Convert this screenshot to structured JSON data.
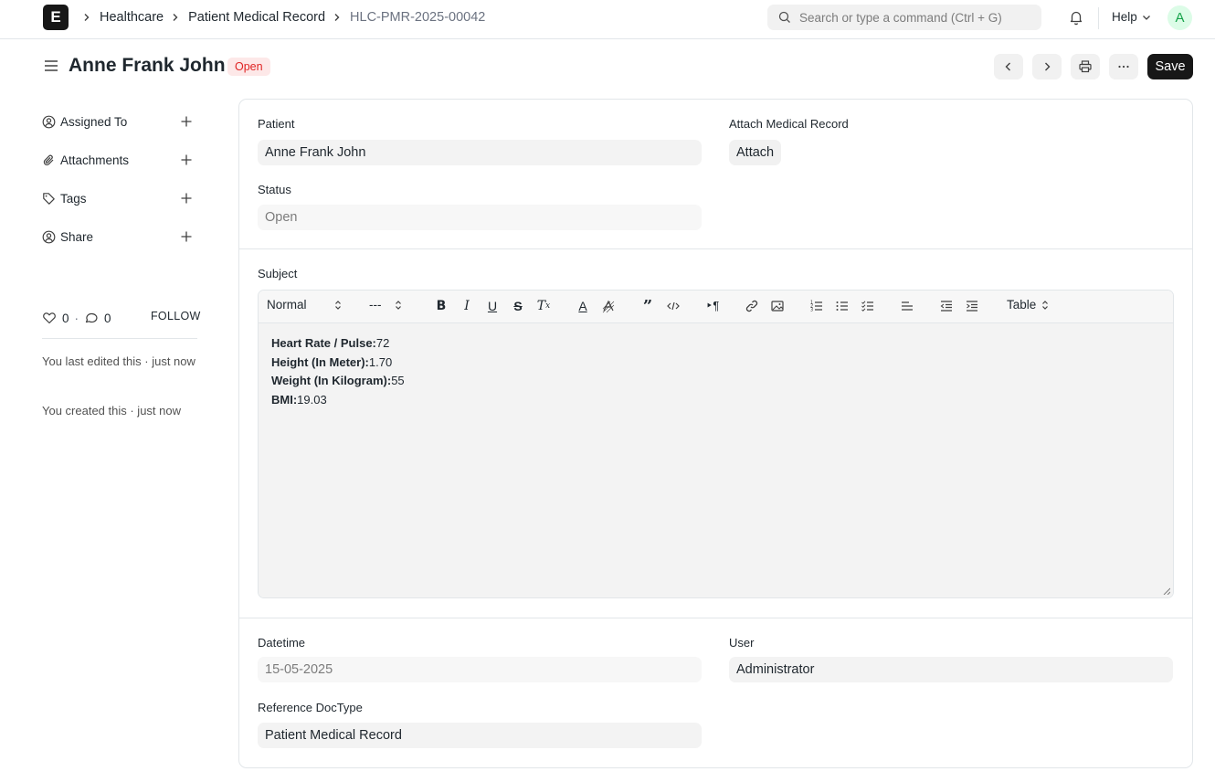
{
  "navbar": {
    "logo_letter": "E",
    "breadcrumbs": [
      "Healthcare",
      "Patient Medical Record",
      "HLC-PMR-2025-00042"
    ],
    "search_placeholder": "Search or type a command (Ctrl + G)",
    "help_label": "Help",
    "avatar_letter": "A"
  },
  "page": {
    "title": "Anne Frank John",
    "status": "Open",
    "save_label": "Save",
    "colors": {
      "status_bg": "#fde8e8",
      "status_text": "#e02424",
      "primary": "#171717"
    }
  },
  "sidebar": {
    "items": [
      {
        "label": "Assigned To",
        "icon": "user-circle-icon"
      },
      {
        "label": "Attachments",
        "icon": "paperclip-icon"
      },
      {
        "label": "Tags",
        "icon": "tag-icon"
      },
      {
        "label": "Share",
        "icon": "share-user-icon"
      }
    ],
    "likes": "0",
    "comments": "0",
    "follow_label": "FOLLOW",
    "last_edited": "You last edited this · just now",
    "created": "You created this · just now"
  },
  "form": {
    "patient": {
      "label": "Patient",
      "value": "Anne Frank John"
    },
    "attach": {
      "label": "Attach Medical Record",
      "button": "Attach"
    },
    "status": {
      "label": "Status",
      "placeholder": "Open"
    },
    "subject": {
      "label": "Subject",
      "toolbar": {
        "format": "Normal",
        "size": "---",
        "table": "Table"
      },
      "lines": [
        {
          "key": "Heart Rate / Pulse:",
          "value": "72"
        },
        {
          "key": "Height (In Meter):",
          "value": "1.70"
        },
        {
          "key": "Weight (In Kilogram):",
          "value": "55"
        },
        {
          "key": "BMI:",
          "value": "19.03"
        }
      ]
    },
    "datetime": {
      "label": "Datetime",
      "value": "15-05-2025"
    },
    "user": {
      "label": "User",
      "value": "Administrator"
    },
    "reference_doctype": {
      "label": "Reference DocType",
      "value": "Patient Medical Record"
    }
  }
}
